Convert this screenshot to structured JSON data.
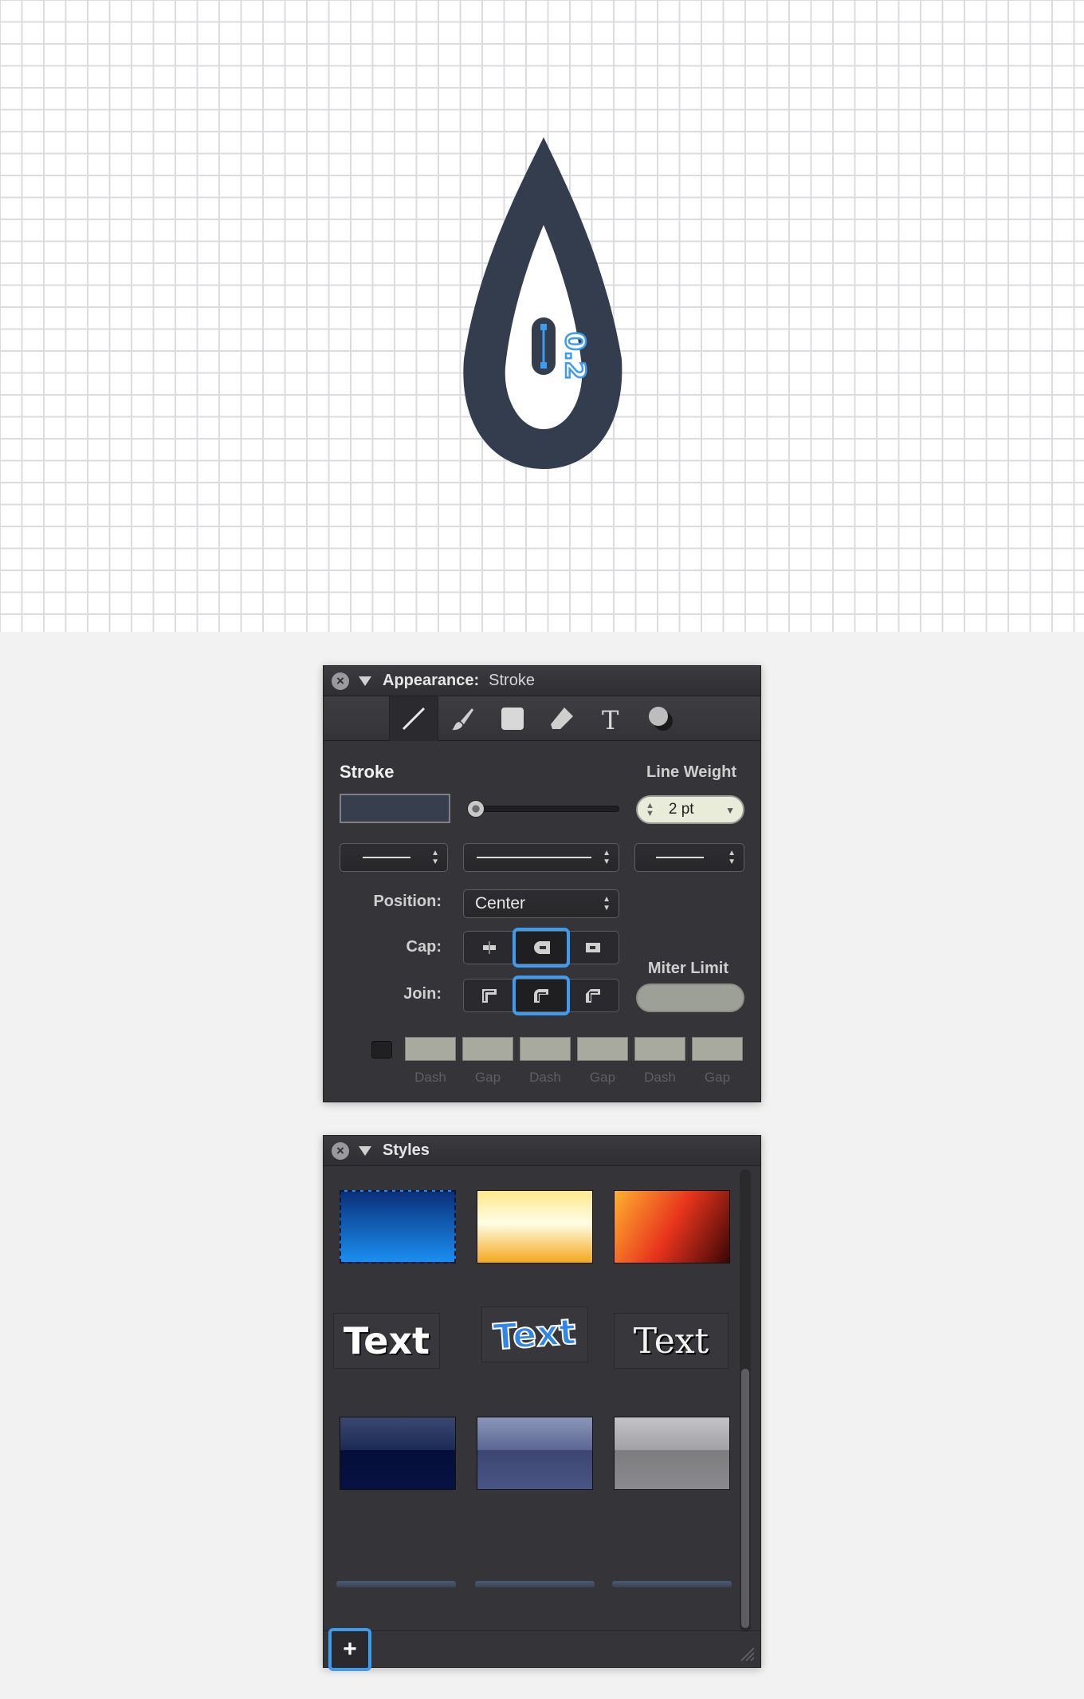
{
  "canvas": {
    "shape": "teardrop",
    "shape_color": "#343d4d",
    "dimension_label": "0.2",
    "accent_color": "#3d9bf0"
  },
  "appearance_panel": {
    "title": "Appearance:",
    "subtitle": "Stroke",
    "tools": [
      "line-tool-icon",
      "brush-icon",
      "fill-square-icon",
      "eraser-icon",
      "text-T-icon",
      "shadow-circles-icon"
    ],
    "stroke_label": "Stroke",
    "line_weight_label": "Line Weight",
    "stroke_color": "#373e4e",
    "line_weight_value": "2 pt",
    "position_label": "Position:",
    "position_value": "Center",
    "cap_label": "Cap:",
    "join_label": "Join:",
    "miter_limit_label": "Miter Limit",
    "dash_labels": [
      "Dash",
      "Gap",
      "Dash",
      "Gap",
      "Dash",
      "Gap"
    ]
  },
  "styles_panel": {
    "title": "Styles",
    "text_samples": [
      "Text",
      "Text",
      "Text"
    ],
    "add_button": "+"
  }
}
